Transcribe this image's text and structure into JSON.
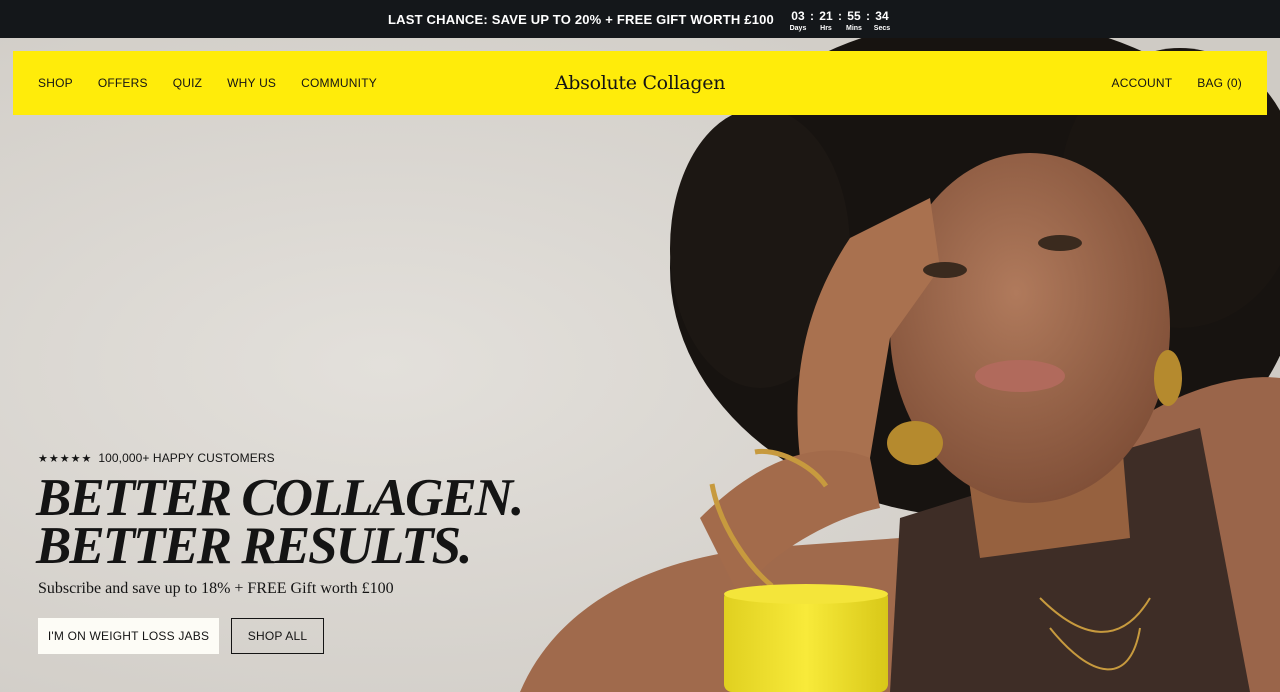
{
  "announcement": {
    "text": "LAST CHANCE: SAVE UP TO 20% + FREE GIFT WORTH £100",
    "countdown": [
      {
        "value": "03",
        "label": "Days"
      },
      {
        "value": "21",
        "label": "Hrs"
      },
      {
        "value": "55",
        "label": "Mins"
      },
      {
        "value": "34",
        "label": "Secs"
      }
    ]
  },
  "nav": {
    "left": [
      "SHOP",
      "OFFERS",
      "QUIZ",
      "WHY US",
      "COMMUNITY"
    ],
    "logo": "Absolute Collagen",
    "account": "ACCOUNT",
    "bag": "BAG (0)",
    "background": "#ffec0a"
  },
  "hero": {
    "stars": "★★★★★",
    "rating_text": "100,000+ HAPPY CUSTOMERS",
    "headline_line1": "BETTER COLLAGEN.",
    "headline_line2": "BETTER RESULTS.",
    "subline": "Subscribe and save up to 18% + FREE Gift worth £100",
    "primary_button": "I'M ON WEIGHT LOSS JABS",
    "secondary_button": "SHOP ALL"
  }
}
